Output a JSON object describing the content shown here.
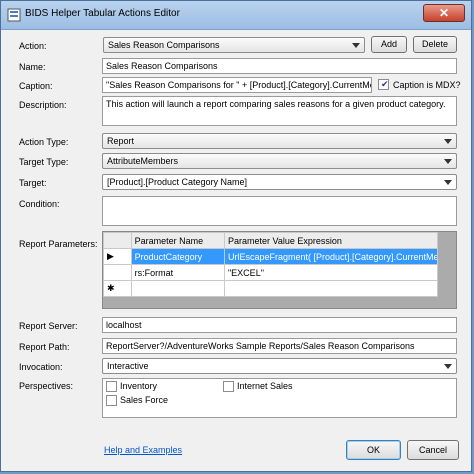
{
  "window": {
    "title": "BIDS Helper Tabular Actions Editor",
    "close_glyph": "✕"
  },
  "labels": {
    "action": "Action:",
    "name": "Name:",
    "caption": "Caption:",
    "description": "Description:",
    "action_type": "Action Type:",
    "target_type": "Target Type:",
    "target": "Target:",
    "condition": "Condition:",
    "report_parameters": "Report Parameters:",
    "report_server": "Report Server:",
    "report_path": "Report Path:",
    "invocation": "Invocation:",
    "perspectives": "Perspectives:"
  },
  "action": {
    "selected": "Sales Reason Comparisons",
    "add_label": "Add",
    "delete_label": "Delete"
  },
  "name_value": "Sales Reason Comparisons",
  "caption_value": "\"Sales Reason Comparisons for \" + [Product].[Category].CurrentMember.N",
  "caption_is_mdx": {
    "label": "Caption is MDX?",
    "checked": true
  },
  "description_value": "This action will launch a report comparing sales reasons for a given product category.",
  "action_type": "Report",
  "target_type": "AttributeMembers",
  "target": "[Product].[Product Category Name]",
  "condition_value": "",
  "params": {
    "headers": [
      "Parameter Name",
      "Parameter Value Expression"
    ],
    "rows": [
      {
        "marker": "▶",
        "name": "ProductCategory",
        "value": "UrlEscapeFragment( [Product].[Category].CurrentMem"
      },
      {
        "marker": "",
        "name": "rs:Format",
        "value": "\"EXCEL\""
      },
      {
        "marker": "✱",
        "name": "",
        "value": ""
      }
    ]
  },
  "report_server": "localhost",
  "report_path": "ReportServer?/AdventureWorks Sample Reports/Sales Reason Comparisons",
  "invocation": "Interactive",
  "perspectives": [
    "Inventory",
    "Internet Sales",
    "Sales Force"
  ],
  "footer": {
    "help_link": "Help and Examples",
    "ok_label": "OK",
    "cancel_label": "Cancel"
  }
}
